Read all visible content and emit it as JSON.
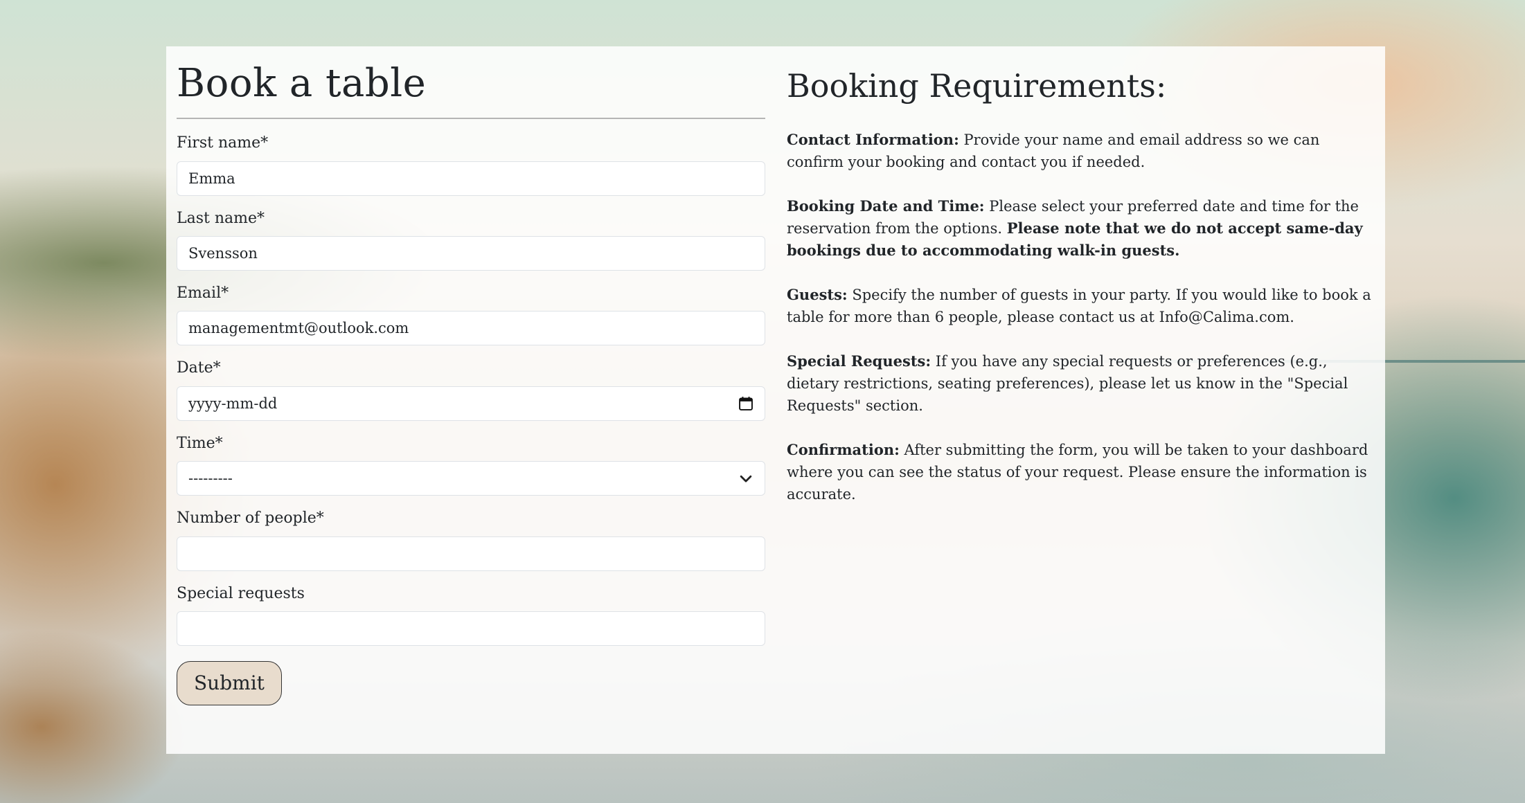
{
  "form": {
    "title": "Book a table",
    "first_name": {
      "label": "First name*",
      "value": "Emma"
    },
    "last_name": {
      "label": "Last name*",
      "value": "Svensson"
    },
    "email": {
      "label": "Email*",
      "value": "managementmt@outlook.com"
    },
    "date": {
      "label": "Date*",
      "placeholder": "yyyy-mm-dd",
      "icon": "calendar-icon"
    },
    "time": {
      "label": "Time*",
      "selected": "---------",
      "icon": "chevron-down-icon"
    },
    "people": {
      "label": "Number of people*",
      "value": ""
    },
    "special": {
      "label": "Special requests",
      "value": ""
    },
    "submit_label": "Submit"
  },
  "requirements": {
    "title": "Booking Requirements:",
    "contact": {
      "heading": "Contact Information:",
      "text": " Provide your name and email address so we can confirm your booking and contact you if needed."
    },
    "datetime": {
      "heading": "Booking Date and Time:",
      "text": " Please select your preferred date and time for the reservation from the options. ",
      "emphasis": "Please note that we do not accept same-day bookings due to accommodating walk-in guests."
    },
    "guests": {
      "heading": "Guests:",
      "text": " Specify the number of guests in your party. If you would like to book a table for more than 6 people, please contact us at Info@Calima.com."
    },
    "special": {
      "heading": "Special Requests:",
      "text": " If you have any special requests or preferences (e.g., dietary restrictions, seating preferences), please let us know in the \"Special Requests\" section."
    },
    "confirmation": {
      "heading": "Confirmation:",
      "text": " After submitting the form, you will be taken to your dashboard where you can see the status of your request. Please ensure the information is accurate."
    }
  },
  "colors": {
    "panel": "#ffffff",
    "submit_bg": "#e8dccd",
    "text": "#212529",
    "input_border": "#dee2e6"
  }
}
